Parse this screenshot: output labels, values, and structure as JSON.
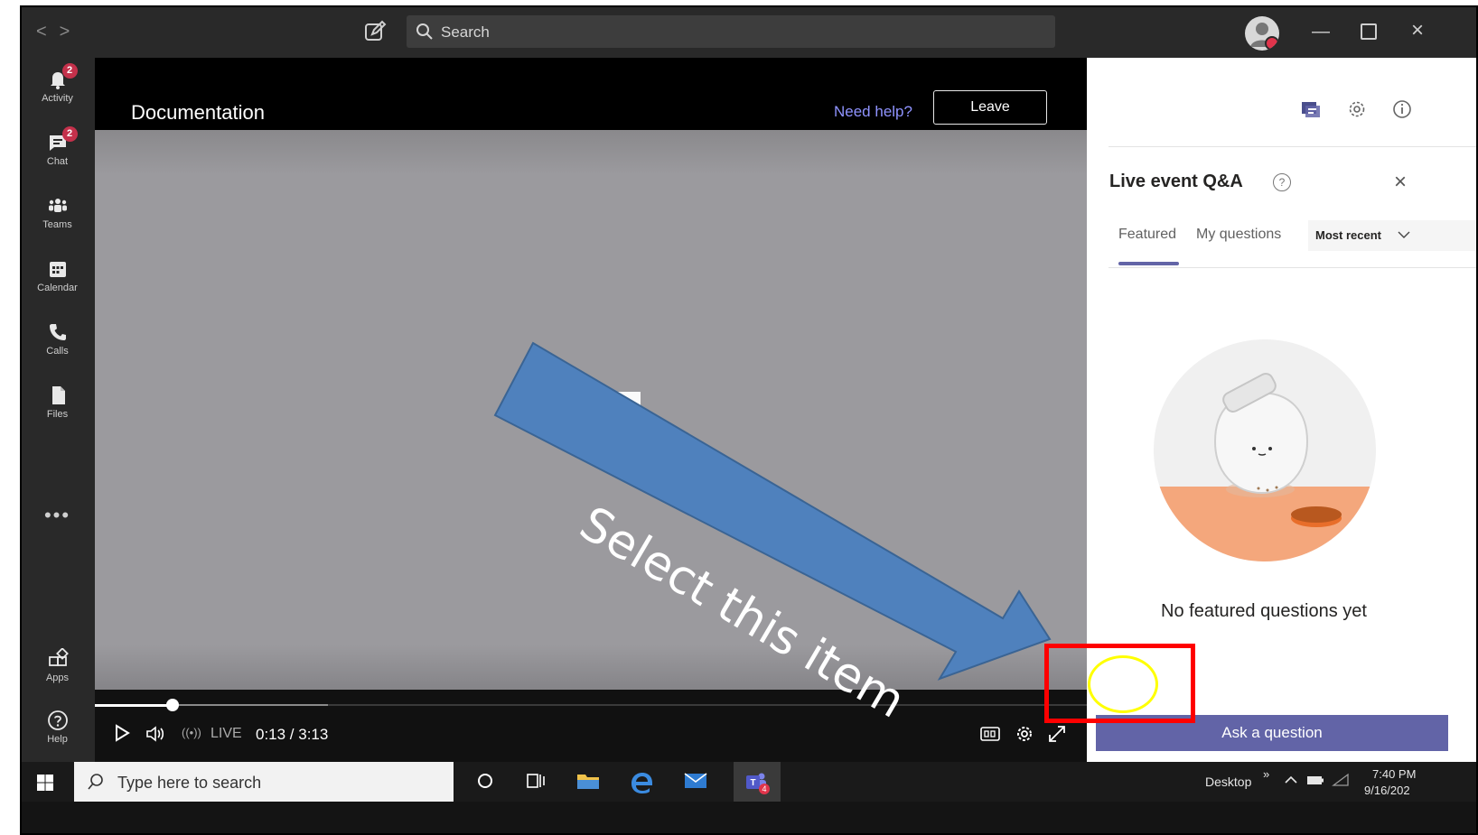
{
  "titlebar": {
    "search_placeholder": "Search"
  },
  "appbar": {
    "items": [
      {
        "label": "Activity",
        "badge": "2",
        "icon": "bell-icon"
      },
      {
        "label": "Chat",
        "badge": "2",
        "icon": "chat-icon"
      },
      {
        "label": "Teams",
        "icon": "teams-icon"
      },
      {
        "label": "Calendar",
        "icon": "calendar-icon"
      },
      {
        "label": "Calls",
        "icon": "phone-icon"
      },
      {
        "label": "Files",
        "icon": "file-icon"
      }
    ],
    "more": "•••",
    "apps_label": "Apps",
    "help_label": "Help"
  },
  "video": {
    "title": "Documentation",
    "need_help": "Need help?",
    "leave": "Leave",
    "live": "LIVE",
    "time": "0:13 / 3:13",
    "progress": 0.069
  },
  "qa": {
    "title": "Live event Q&A",
    "tabs": [
      "Featured",
      "My questions"
    ],
    "sort": "Most recent",
    "empty": "No featured questions yet",
    "ask": "Ask a question"
  },
  "taskbar": {
    "search": "Type here to search",
    "desktop": "Desktop",
    "clock_time": "7:40 PM",
    "clock_date": "9/16/202"
  },
  "annotation": {
    "arrow_text": "Select this item"
  },
  "colors": {
    "accent": "#6264a7",
    "badge": "#c4314b",
    "highlight_box": "#ff0000",
    "highlight_ring": "#ffff00",
    "arrow_fill": "#4f81bd"
  }
}
